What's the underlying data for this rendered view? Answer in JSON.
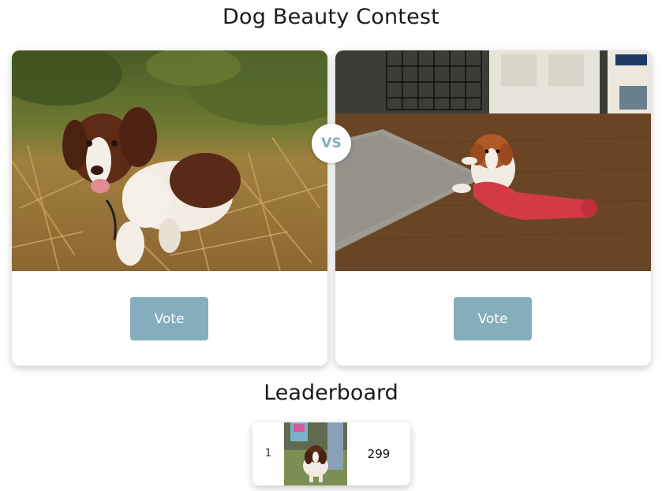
{
  "title": "Dog Beauty Contest",
  "contest": {
    "vs_label": "VS",
    "left": {
      "vote_label": "Vote",
      "photo_icon": "springer-spaniel-running-photo"
    },
    "right": {
      "vote_label": "Vote",
      "photo_icon": "puppy-with-red-toy-photo"
    }
  },
  "leaderboard": {
    "title": "Leaderboard",
    "rows": [
      {
        "rank": "1",
        "votes": "299",
        "photo_icon": "spaniel-standing-on-grass-photo"
      }
    ]
  },
  "colors": {
    "accent": "#84aebc",
    "button_text": "#ffffff",
    "background": "#ffffff"
  }
}
